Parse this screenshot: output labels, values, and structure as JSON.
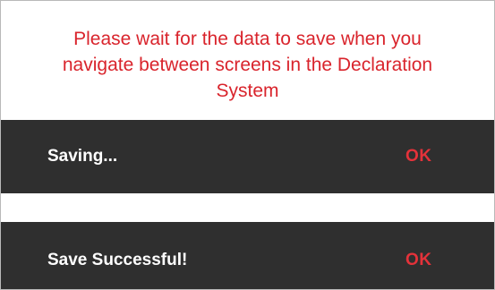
{
  "notice": {
    "text": "Please wait for the data to save when you\nnavigate between screens in the Declaration\nSystem",
    "color": "#d9242c"
  },
  "snackbars": [
    {
      "message": "Saving...",
      "action_label": "OK",
      "background": "#2f2f2f"
    },
    {
      "message": "Save Successful!",
      "action_label": "OK",
      "background": "#2f2f2f"
    }
  ],
  "accent_color": "#e4323a"
}
